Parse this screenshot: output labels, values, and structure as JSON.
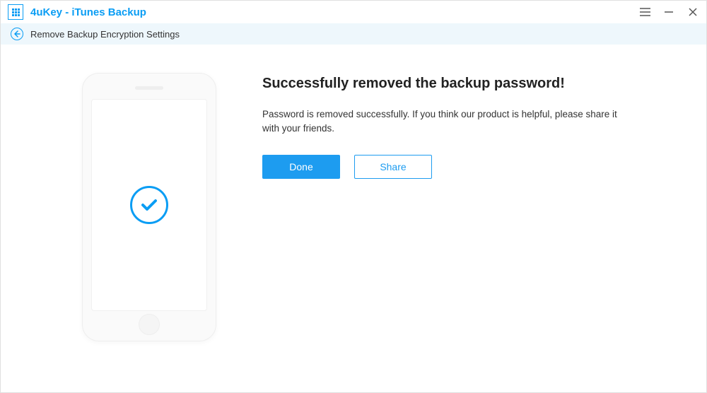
{
  "app": {
    "title": "4uKey - iTunes Backup"
  },
  "subheader": {
    "title": "Remove Backup Encryption Settings"
  },
  "main": {
    "heading": "Successfully removed the backup password!",
    "description": "Password is removed successfully. If you think our product is helpful, please share it with your friends.",
    "done_label": "Done",
    "share_label": "Share"
  }
}
